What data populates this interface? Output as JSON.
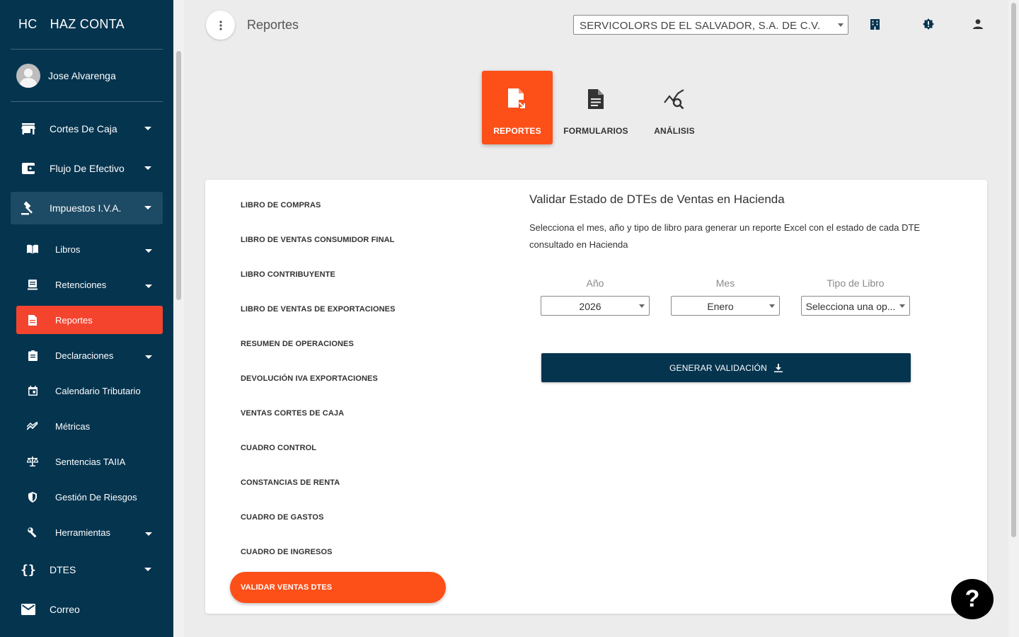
{
  "brand": {
    "short": "HC",
    "name": "HAZ CONTA"
  },
  "user": {
    "name": "Jose Alvarenga"
  },
  "sidebar": {
    "groups": [
      {
        "label": "Cortes De Caja",
        "icon": "store-icon"
      },
      {
        "label": "Flujo De Efectivo",
        "icon": "wallet-icon"
      },
      {
        "label": "Impuestos I.V.A.",
        "icon": "gavel-icon"
      }
    ],
    "sub_items": [
      {
        "label": "Libros",
        "icon": "book-icon"
      },
      {
        "label": "Retenciones",
        "icon": "receipt-icon"
      },
      {
        "label": "Reportes",
        "icon": "document-icon"
      },
      {
        "label": "Declaraciones",
        "icon": "clipboard-icon"
      },
      {
        "label": "Calendario Tributario",
        "icon": "calendar-icon"
      },
      {
        "label": "Métricas",
        "icon": "chart-line-icon"
      },
      {
        "label": "Sentencias TAIIA",
        "icon": "scale-icon"
      },
      {
        "label": "Gestión De Riesgos",
        "icon": "shield-icon"
      },
      {
        "label": "Herramientas",
        "icon": "wrench-icon"
      }
    ],
    "bottom_items": [
      {
        "label": "DTES",
        "icon": "braces-icon"
      },
      {
        "label": "Correo",
        "icon": "mail-icon"
      }
    ]
  },
  "header": {
    "title": "Reportes",
    "company": "SERVICOLORS DE EL SALVADOR, S.A. DE C.V."
  },
  "top_tabs": [
    "REPORTES",
    "FORMULARIOS",
    "ANÁLISIS"
  ],
  "reports": [
    "LIBRO DE COMPRAS",
    "LIBRO DE VENTAS CONSUMIDOR FINAL",
    "LIBRO CONTRIBUYENTE",
    "LIBRO DE VENTAS DE EXPORTACIONES",
    "RESUMEN DE OPERACIONES",
    "DEVOLUCIÓN IVA EXPORTACIONES",
    "VENTAS CORTES DE CAJA",
    "CUADRO CONTROL",
    "CONSTANCIAS DE RENTA",
    "CUADRO DE GASTOS",
    "CUADRO DE INGRESOS",
    "VALIDAR VENTAS DTES"
  ],
  "panel": {
    "title": "Validar Estado de DTEs de Ventas en Hacienda",
    "description": "Selecciona el mes, año y tipo de libro para generar un reporte Excel con el estado de cada DTE consultado en Hacienda",
    "fields": {
      "year": {
        "label": "Año",
        "value": "2026"
      },
      "month": {
        "label": "Mes",
        "value": "Enero"
      },
      "book_type": {
        "label": "Tipo de Libro",
        "value": "Selecciona una op..."
      }
    },
    "button": "GENERAR VALIDACIÓN"
  },
  "help": "?",
  "colors": {
    "sidebar": "#05344f",
    "accent": "#fd4f18",
    "active_sub": "#f4442e"
  }
}
